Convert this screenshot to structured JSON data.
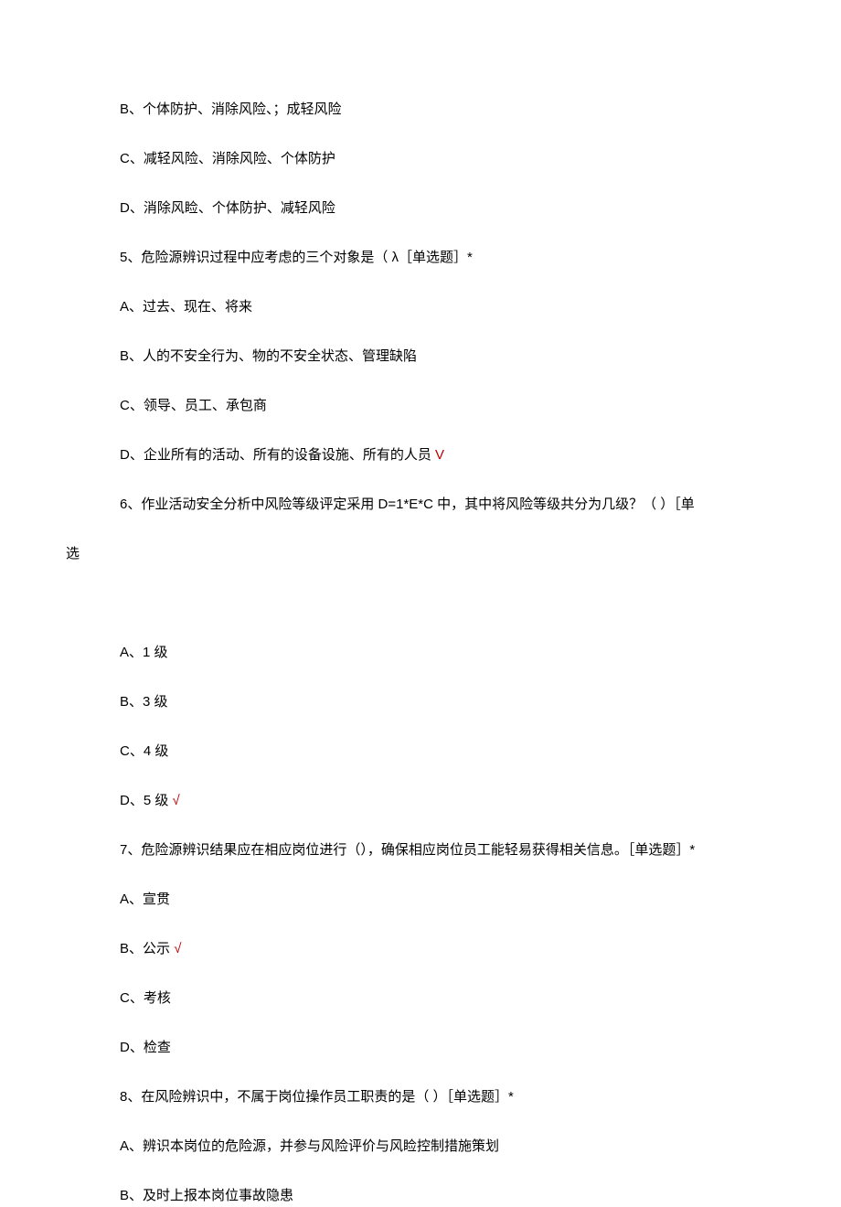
{
  "lines": {
    "q4_optB": "B、个体防护、消除风险、；成轻风险",
    "q4_optC": "C、减轻风险、消除风险、个体防护",
    "q4_optD": "D、消除风睑、个体防护、减轻风险",
    "q5_stem": "5、危险源辨识过程中应考虑的三个对象是（      λ［单选题］*",
    "q5_optA": "A、过去、现在、将来",
    "q5_optB": "B、人的不安全行为、物的不安全状态、管理缺陷",
    "q5_optC": "C、领导、员工、承包商",
    "q5_optD_pre": "D、企业所有的活动、所有的设备设施、所有的人员 ",
    "q5_optD_mark": "V",
    "q6_stem": "6、作业活动安全分析中风险等级评定采用 D=1*E*C 中，其中将风险等级共分为几级？（         ）［单",
    "q6_stem_cont": "选",
    "q6_optA": "A、1 级",
    "q6_optB": "B、3 级",
    "q6_optC": "C、4 级",
    "q6_optD_pre": "D、5 级 ",
    "q6_optD_mark": "√",
    "q7_stem": "7、危险源辨识结果应在相应岗位进行（），确保相应岗位员工能轻易获得相关信息。［单选题］*",
    "q7_optA": "A、宣贯",
    "q7_optB_pre": "B、公示 ",
    "q7_optB_mark": "√",
    "q7_optC": "C、考核",
    "q7_optD": "D、检查",
    "q8_stem": "8、在风险辨识中，不属于岗位操作员工职责的是（          ）［单选题］*",
    "q8_optA": "A、辨识本岗位的危险源，并参与风险评价与风睑控制措施策划",
    "q8_optB": "B、及时上报本岗位事故隐患"
  }
}
